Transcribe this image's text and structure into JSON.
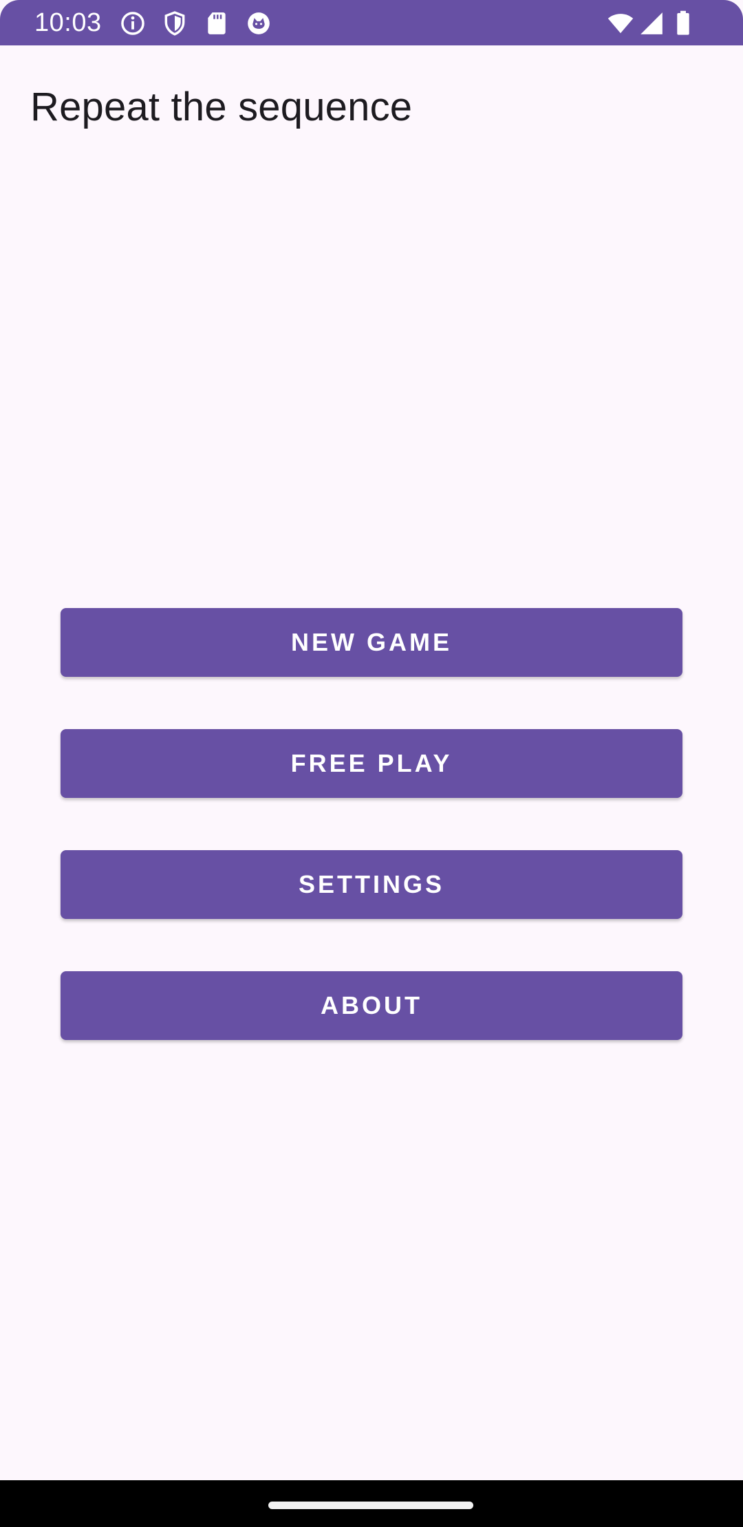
{
  "status_bar": {
    "time": "10:03",
    "left_icons": [
      "info-icon",
      "shield-icon",
      "sd-card-icon",
      "cat-face-icon"
    ],
    "right_icons": [
      "wifi-icon",
      "cell-signal-icon",
      "battery-icon"
    ],
    "color": "#6750a4"
  },
  "app": {
    "title": "Repeat the sequence"
  },
  "menu": {
    "new_game": "NEW GAME",
    "free_play": "FREE PLAY",
    "settings": "SETTINGS",
    "about": "ABOUT"
  },
  "colors": {
    "primary": "#6750a4",
    "background": "#fdf7fd",
    "on_primary": "#ffffff"
  }
}
